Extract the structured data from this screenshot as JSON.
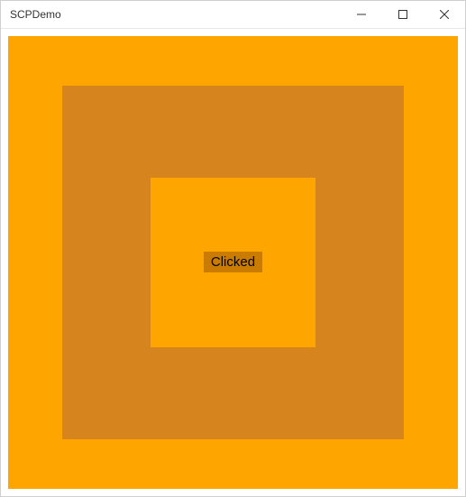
{
  "window": {
    "title": "SCPDemo"
  },
  "button": {
    "label": "Clicked"
  },
  "colors": {
    "outer": "#ffa500",
    "middle": "#d6851e",
    "inner": "#ffa500",
    "button_bg": "#c97c00"
  }
}
